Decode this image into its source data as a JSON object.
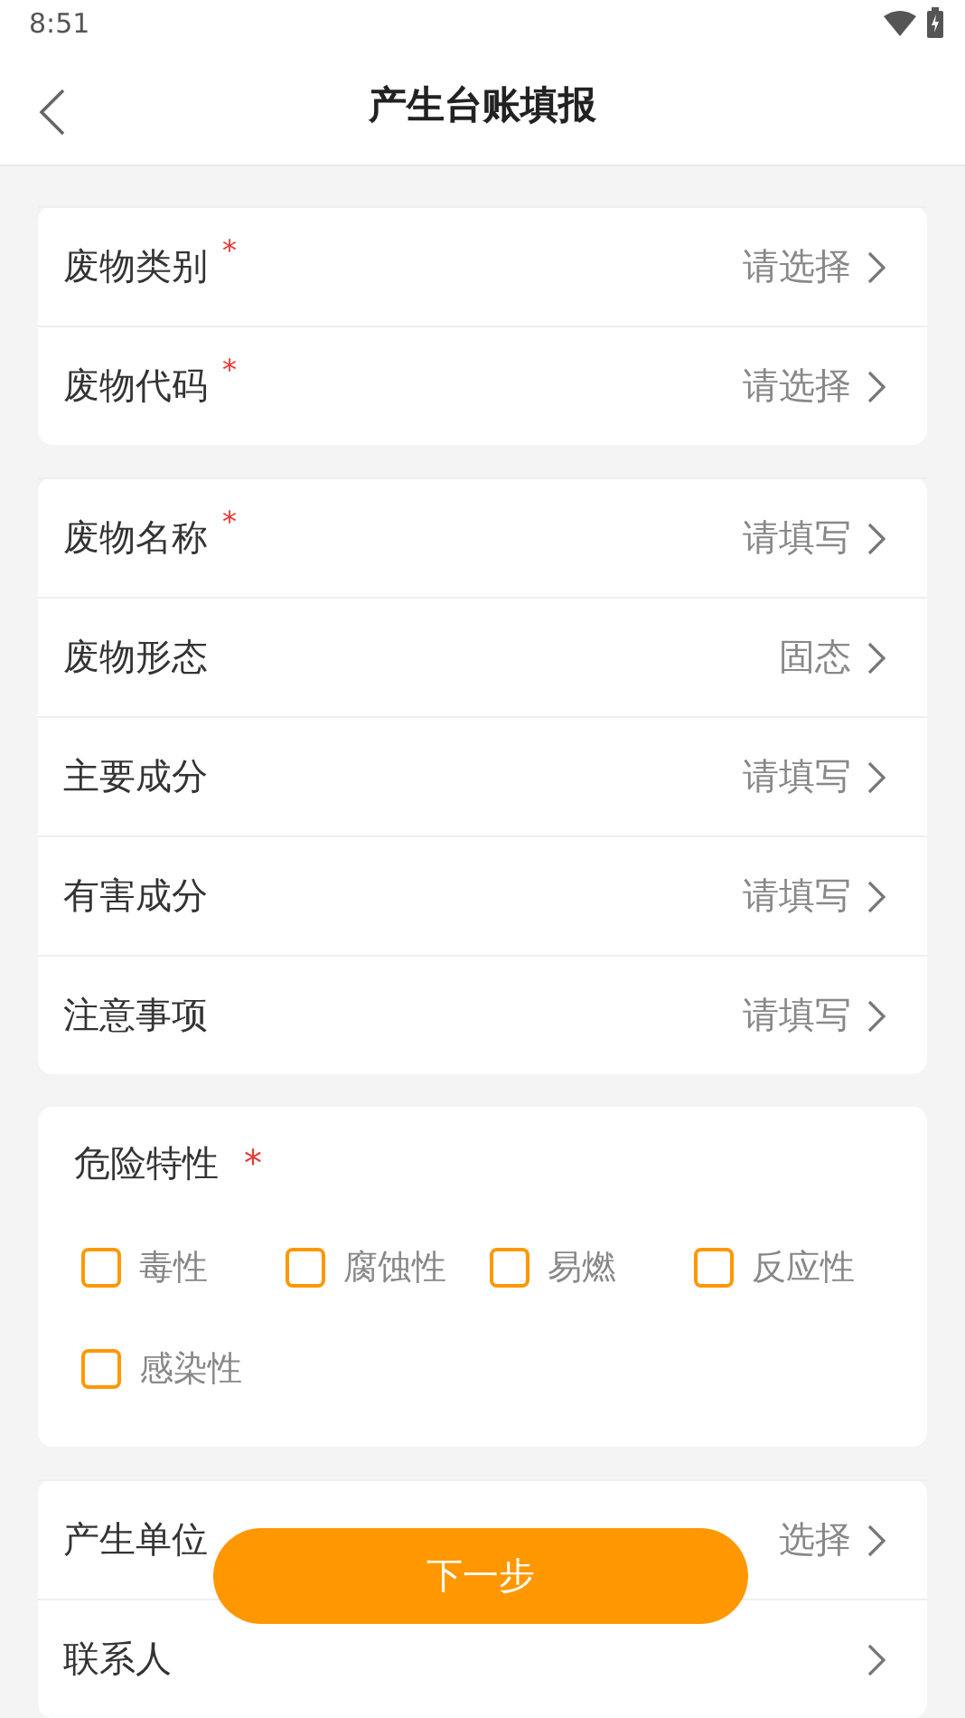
{
  "status_bar": {
    "time": "8:51"
  },
  "header": {
    "title": "产生台账填报"
  },
  "cards": [
    {
      "kind": "rows",
      "rows": [
        {
          "label": "废物类别",
          "mark": "*",
          "value": "请选择"
        },
        {
          "label": "废物代码",
          "mark": "*",
          "value": "请选择"
        }
      ]
    },
    {
      "kind": "rows",
      "rows": [
        {
          "label": "废物名称",
          "mark": "*",
          "value": "请填写"
        },
        {
          "label": "废物形态",
          "value": "固态"
        },
        {
          "label": "主要成分",
          "value": "请填写"
        },
        {
          "label": "有害成分",
          "value": "请填写"
        },
        {
          "label": "注意事项",
          "value": "请填写"
        }
      ]
    },
    {
      "kind": "checks",
      "label": "危险特性",
      "mark": "*",
      "options": [
        {
          "label": "毒性",
          "checked": false
        },
        {
          "label": "腐蚀性",
          "checked": false
        },
        {
          "label": "易燃",
          "checked": false
        },
        {
          "label": "反应性",
          "checked": false
        },
        {
          "label": "感染性",
          "checked": false
        }
      ]
    },
    {
      "kind": "rows",
      "rows": [
        {
          "label": "产生单位",
          "value": "选择"
        },
        {
          "label": "联系人"
        }
      ]
    }
  ],
  "next_button": {
    "label": "下一步"
  }
}
